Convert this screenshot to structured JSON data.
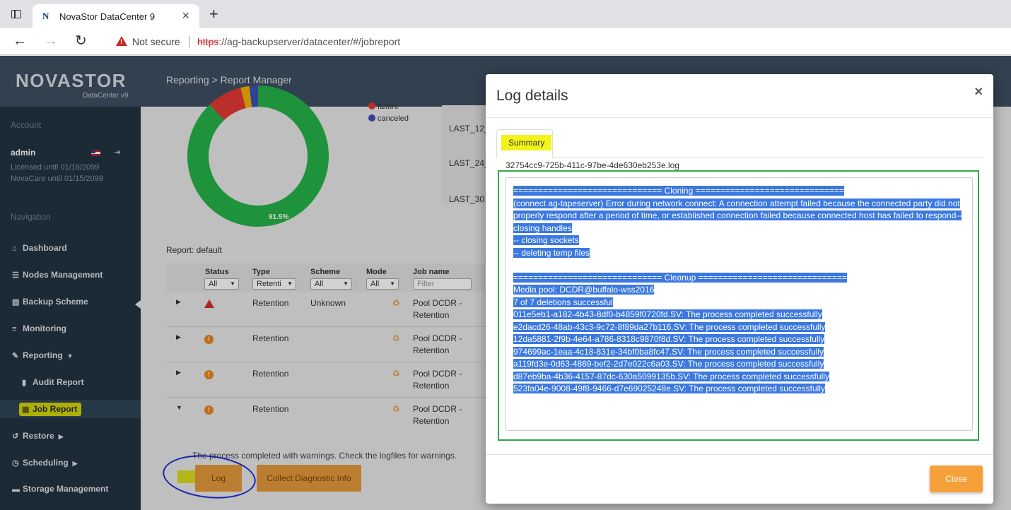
{
  "browser": {
    "tab_title": "NovaStor DataCenter 9",
    "favicon_letter": "N",
    "security_label": "Not secure",
    "url_scheme": "https",
    "url_rest": "://ag-backupserver/datacenter/#/jobreport"
  },
  "app": {
    "logo": "NOVASTOR",
    "logo_sub": "DataCenter v9",
    "breadcrumb": "Reporting > Report Manager"
  },
  "sidebar": {
    "account_label": "Account",
    "user": "admin",
    "licensed": "Licensed until 01/16/2099",
    "novacare": "NovaCare until 01/15/2099",
    "navigation_label": "Navigation",
    "items": [
      {
        "label": "Dashboard",
        "icon": "home-icon"
      },
      {
        "label": "Nodes Management",
        "icon": "server-icon"
      },
      {
        "label": "Backup Scheme",
        "icon": "document-icon"
      },
      {
        "label": "Monitoring",
        "icon": "list-icon"
      },
      {
        "label": "Reporting",
        "icon": "edit-icon"
      },
      {
        "label": "Audit Report",
        "icon": "file-icon"
      },
      {
        "label": "Job Report",
        "icon": "calendar-icon"
      },
      {
        "label": "Restore",
        "icon": "undo-icon"
      },
      {
        "label": "Scheduling",
        "icon": "clock-icon"
      },
      {
        "label": "Storage Management",
        "icon": "storage-icon"
      }
    ]
  },
  "chart": {
    "percent_label": "91.5%",
    "legend": [
      "failure",
      "canceled"
    ],
    "colors": {
      "success": "#27b24a",
      "failure": "#e53935",
      "warning": "#f4b400",
      "canceled": "#3f51b5"
    }
  },
  "periods": [
    "LAST_12_",
    "LAST_24_",
    "LAST_30"
  ],
  "report_label": "Report: default",
  "grid": {
    "columns": [
      "Status",
      "Type",
      "Scheme",
      "Mode",
      "Job name"
    ],
    "filters": [
      "All",
      "Retenti",
      "All",
      "All"
    ],
    "jobname_placeholder": "Filter",
    "rows": [
      {
        "type": "Retention",
        "scheme": "Unknown",
        "job_line1": "Pool DCDR -",
        "job_line2": "Retention"
      },
      {
        "type": "Retention",
        "scheme": "",
        "job_line1": "Pool DCDR -",
        "job_line2": "Retention"
      },
      {
        "type": "Retention",
        "scheme": "",
        "job_line1": "Pool DCDR -",
        "job_line2": "Retention"
      },
      {
        "type": "Retention",
        "scheme": "",
        "job_line1": "Pool DCDR -",
        "job_line2": "Retention"
      }
    ]
  },
  "warning_text": "The process completed with warnings. Check the logfiles for warnings.",
  "log_button": "Log",
  "diag_button": "Collect Diagnostic Info",
  "modal": {
    "title": "Log details",
    "close_x": "×",
    "tab": "Summary",
    "filename": "32754cc9-725b-411c-97be-4de630eb253e.log",
    "lines": [
      "============================== Cloning ==============================",
      "(connect ag-tapeserver) Error during network connect: A connection attempt failed because the connected party did not",
      "properly respond after a period of time, or established connection failed because connected host has failed to respond--",
      "closing handles",
      "-- closing sockets",
      "-- deleting temp files",
      " ",
      "============================== Cleanup ==============================",
      "Media pool: DCDR@buffalo-wss2016",
      "7 of 7 deletions successful",
      "011e5eb1-a182-4b43-8df0-b4859f0720fd.SV: The process completed successfully",
      "e2dacd26-48ab-43c3-9c72-8f89da27b116.SV: The process completed successfully",
      "12da5881-2f9b-4e64-a786-8318c9870f8d.SV: The process completed successfully",
      "974699ac-1eaa-4c18-831e-34bf0ba8fc47.SV: The process completed successfully",
      "a119fd3e-0d63-4869-bef2-2d7e022c6a03.SV: The process completed successfully",
      "d87eb9ba-4b36-4157-87dc-630a5099135b.SV: The process completed successfully",
      "523fa04e-9008-49f8-9466-d7e69025248e.SV: The process completed successfully"
    ],
    "close_button": "Close"
  }
}
